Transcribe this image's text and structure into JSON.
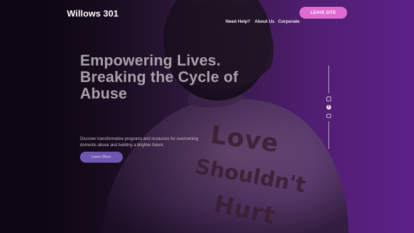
{
  "header": {
    "logo": "Willows 301",
    "nav": {
      "need_help": "Need Help?",
      "about_us": "About Us",
      "corporate": "Corporate"
    },
    "leave_site": "LEAVE SITE"
  },
  "hero": {
    "headline": "Empowering Lives. Breaking the Cycle of Abuse",
    "subtext": "Discover transformative programs and resources for overcoming domestic abuse and building a brighter future.",
    "cta": "Learn More",
    "back_writing": {
      "line1": "Love",
      "line2": "Shouldn't",
      "line3": "Hurt"
    }
  },
  "social": {
    "icons": [
      "instagram-icon",
      "facebook-icon",
      "youtube-icon"
    ]
  },
  "colors": {
    "accent": "#e06bd0",
    "cta": "#6e57b0",
    "purple": "#5b1f86"
  }
}
